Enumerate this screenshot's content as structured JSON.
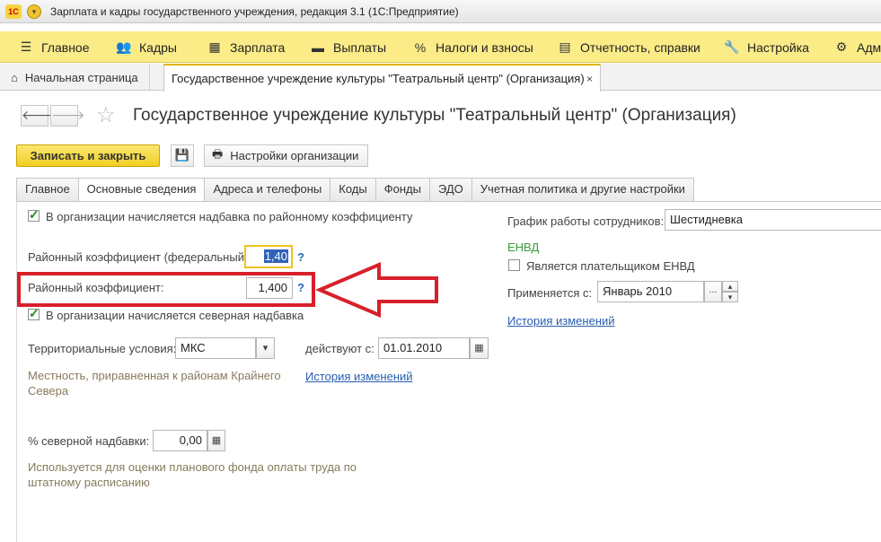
{
  "window": {
    "title": "Зарплата и кадры государственного учреждения, редакция 3.1  (1С:Предприятие)",
    "logo": "1С"
  },
  "sections": [
    {
      "icon": "menu-icon",
      "glyph": "☰",
      "label": "Главное"
    },
    {
      "icon": "people-icon",
      "glyph": "👥",
      "label": "Кадры"
    },
    {
      "icon": "calculator-icon",
      "glyph": "▦",
      "label": "Зарплата"
    },
    {
      "icon": "wallet-icon",
      "glyph": "▬",
      "label": "Выплаты"
    },
    {
      "icon": "percent-icon",
      "glyph": "%",
      "label": "Налоги и взносы"
    },
    {
      "icon": "report-icon",
      "glyph": "▤",
      "label": "Отчетность, справки"
    },
    {
      "icon": "wrench-icon",
      "glyph": "🔧",
      "label": "Настройка"
    },
    {
      "icon": "gear-icon",
      "glyph": "⚙",
      "label": "Адм"
    }
  ],
  "open_tabs": {
    "home": "Начальная страница",
    "current": "Государственное учреждение культуры \"Театральный центр\" (Организация)",
    "close": "×"
  },
  "form": {
    "title": "Государственное учреждение культуры \"Театральный центр\" (Организация)",
    "nav_back": "🡐",
    "nav_forward": "🡒",
    "star": "☆",
    "save_close": "Записать и закрыть",
    "save_icon": "💾",
    "settings": "Настройки организации",
    "print_icon": "🖶"
  },
  "tabs": [
    "Главное",
    "Основные сведения",
    "Адреса и телефоны",
    "Коды",
    "Фонды",
    "ЭДО",
    "Учетная политика и другие настройки"
  ],
  "active_tab": "Основные сведения",
  "left": {
    "regional_allowance_check": "В организации начисляется надбавка по районному коэффициенту",
    "regional_allowance_checked": true,
    "coef_fed_label": "Районный коэффициент (федеральный):",
    "coef_fed_value": "1,40",
    "coef_label": "Районный коэффициент:",
    "coef_value": "1,400",
    "help": "?",
    "northern_check": "В организации начисляется северная надбавка",
    "northern_checked": true,
    "territory_label": "Территориальные условия:",
    "territory_value": "МКС",
    "valid_from_label": "действуют с:",
    "valid_from_value": "01.01.2010",
    "territory_note": "Местность, приравненная к районам Крайнего Севера",
    "history_link": "История изменений",
    "northern_pct_label": "% северной надбавки:",
    "northern_pct_value": "0,00",
    "northern_note": "Используется для оценки планового фонда оплаты труда по штатному расписанию"
  },
  "right": {
    "schedule_label": "График работы сотрудников:",
    "schedule_value": "Шестидневка",
    "envd_header": "ЕНВД",
    "envd_check": "Является плательщиком ЕНВД",
    "envd_checked": false,
    "applies_label": "Применяется с:",
    "applies_value": "Январь 2010",
    "history_link": "История изменений",
    "dots": "...",
    "spin_up": "▴",
    "spin_down": "▾",
    "dropdown": "▾",
    "calendar": "▦"
  },
  "colors": {
    "sections_bar": "#fbec88",
    "accent_button": "#f1cf22",
    "highlight_frame": "#d7202a",
    "link": "#2a5db0",
    "section_header": "#3a9a3a"
  }
}
